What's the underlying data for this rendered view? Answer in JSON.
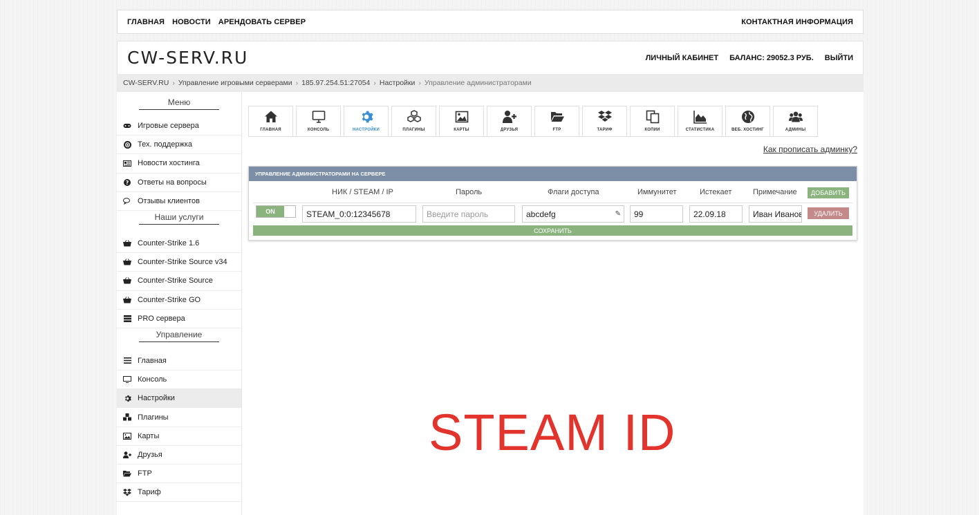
{
  "topnav": {
    "links": [
      "ГЛАВНАЯ",
      "НОВОСТИ",
      "АРЕНДОВАТЬ СЕРВЕР"
    ],
    "contact": "КОНТАКТНАЯ ИНФОРМАЦИЯ"
  },
  "header": {
    "logo": "CW-SERV.RU",
    "account": "ЛИЧНЫЙ КАБИНЕТ",
    "balance": "БАЛАНС: 29052.3 РУБ.",
    "logout": "ВЫЙТИ"
  },
  "breadcrumb": [
    "CW-SERV.RU",
    "Управление игровыми серверами",
    "185.97.254.51:27054",
    "Настройки",
    "Управление администраторами"
  ],
  "sidebar": {
    "menu_title": "Меню",
    "menu": [
      {
        "label": "Игровые сервера",
        "icon": "gamepad-icon"
      },
      {
        "label": "Тех. поддержка",
        "icon": "lifebuoy-icon"
      },
      {
        "label": "Новости хостинга",
        "icon": "newspaper-icon"
      },
      {
        "label": "Ответы на вопросы",
        "icon": "question-icon"
      },
      {
        "label": "Отзывы клиентов",
        "icon": "comments-icon"
      }
    ],
    "services_title": "Наши услуги",
    "services": [
      {
        "label": "Counter-Strike 1.6",
        "icon": "basket-icon"
      },
      {
        "label": "Counter-Strike Source v34",
        "icon": "basket-icon"
      },
      {
        "label": "Counter-Strike Source",
        "icon": "basket-icon"
      },
      {
        "label": "Counter-Strike GO",
        "icon": "basket-icon"
      },
      {
        "label": "PRO сервера",
        "icon": "server-icon"
      }
    ],
    "manage_title": "Управление",
    "manage": [
      {
        "label": "Главная",
        "icon": "bars-icon"
      },
      {
        "label": "Консоль",
        "icon": "monitor-icon"
      },
      {
        "label": "Настройки",
        "icon": "gear-icon"
      },
      {
        "label": "Плагины",
        "icon": "cubes-icon"
      },
      {
        "label": "Карты",
        "icon": "picture-icon"
      },
      {
        "label": "Друзья",
        "icon": "user-plus-icon"
      },
      {
        "label": "FTP",
        "icon": "folder-open-icon"
      },
      {
        "label": "Тариф",
        "icon": "dropbox-icon"
      }
    ]
  },
  "tabs": [
    {
      "label": "ГЛАВНАЯ",
      "icon": "home-icon"
    },
    {
      "label": "КОНСОЛЬ",
      "icon": "monitor-icon"
    },
    {
      "label": "НАСТРОЙКИ",
      "icon": "gear-icon"
    },
    {
      "label": "ПЛАГИНЫ",
      "icon": "cubes-icon"
    },
    {
      "label": "КАРТЫ",
      "icon": "picture-icon"
    },
    {
      "label": "ДРУЗЬЯ",
      "icon": "user-plus-icon"
    },
    {
      "label": "FTP",
      "icon": "folder-open-icon"
    },
    {
      "label": "ТАРИФ",
      "icon": "dropbox-icon"
    },
    {
      "label": "КОПИИ",
      "icon": "copy-icon"
    },
    {
      "label": "СТАТИСТИКА",
      "icon": "area-chart-icon"
    },
    {
      "label": "ВЕБ. ХОСТИНГ",
      "icon": "globe-icon"
    },
    {
      "label": "АДМИНЫ",
      "icon": "users-icon"
    }
  ],
  "active_tab": "НАСТРОЙКИ",
  "help_link": "Как прописать админку?",
  "panel": {
    "title": "УПРАВЛЕНИЕ АДМИНИСТРАТОРАМИ НА СЕРВЕРЕ",
    "columns": {
      "nick": "НИК / STEAM / IP",
      "password": "Пароль",
      "flags": "Флаги доступа",
      "immunity": "Иммунитет",
      "expires": "Истекает",
      "note": "Примечание"
    },
    "add_label": "ДОБАВИТЬ",
    "row": {
      "toggle": "ON",
      "nick": "STEAM_0:0:12345678",
      "password_placeholder": "Введите пароль",
      "flags": "abcdefg",
      "immunity": "99",
      "expires": "22.09.18",
      "note": "Иван Иванов"
    },
    "delete_label": "УДАЛИТЬ",
    "save_label": "СОХРАНИТЬ"
  },
  "overlay_text": "STEAM ID"
}
